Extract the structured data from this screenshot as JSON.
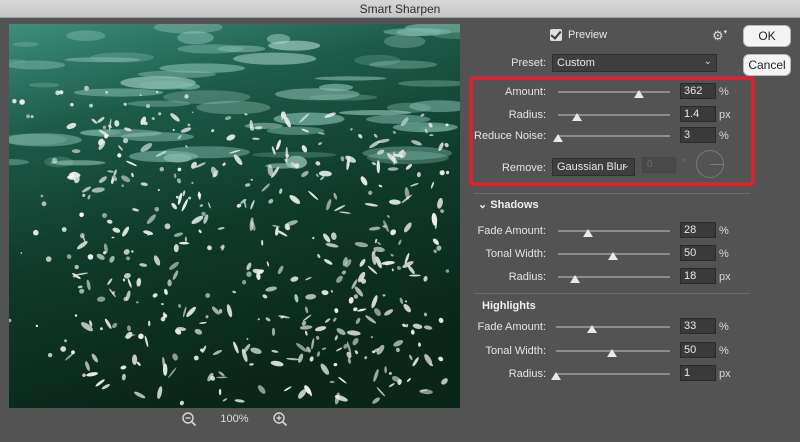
{
  "window": {
    "title": "Smart Sharpen"
  },
  "preview": {
    "label": "Preview",
    "checked": true
  },
  "buttons": {
    "ok": "OK",
    "cancel": "Cancel"
  },
  "preset": {
    "label": "Preset:",
    "value": "Custom"
  },
  "zoom": {
    "level": "100%"
  },
  "main_params": [
    {
      "label": "Amount:",
      "value": "362",
      "unit": "%",
      "slider_fraction": 0.72
    },
    {
      "label": "Radius:",
      "value": "1.4",
      "unit": "px",
      "slider_fraction": 0.17
    },
    {
      "label": "Reduce Noise:",
      "value": "3",
      "unit": "%",
      "slider_fraction": 0.0
    }
  ],
  "remove": {
    "label": "Remove:",
    "value": "Gaussian Blur",
    "angle_field": "0",
    "angle_unit": "°"
  },
  "shadows": {
    "title": "Shadows",
    "params": [
      {
        "label": "Fade Amount:",
        "value": "28",
        "unit": "%",
        "slider_fraction": 0.27
      },
      {
        "label": "Tonal Width:",
        "value": "50",
        "unit": "%",
        "slider_fraction": 0.49
      },
      {
        "label": "Radius:",
        "value": "18",
        "unit": "px",
        "slider_fraction": 0.15
      }
    ]
  },
  "highlights": {
    "title": "Highlights",
    "params": [
      {
        "label": "Fade Amount:",
        "value": "33",
        "unit": "%",
        "slider_fraction": 0.32
      },
      {
        "label": "Tonal Width:",
        "value": "50",
        "unit": "%",
        "slider_fraction": 0.49
      },
      {
        "label": "Radius:",
        "value": "1",
        "unit": "px",
        "slider_fraction": 0.0
      }
    ]
  },
  "colors": {
    "highlight_box": "#d22630",
    "water_dark": "#0b2a1d",
    "water_teal": "#2f7f6f",
    "foam": "#e8efe9"
  },
  "icons": {
    "zoom_out": "zoom-out-icon",
    "zoom_in": "zoom-in-icon",
    "settings": "gear-icon",
    "collapse": "chevron-down-icon"
  }
}
